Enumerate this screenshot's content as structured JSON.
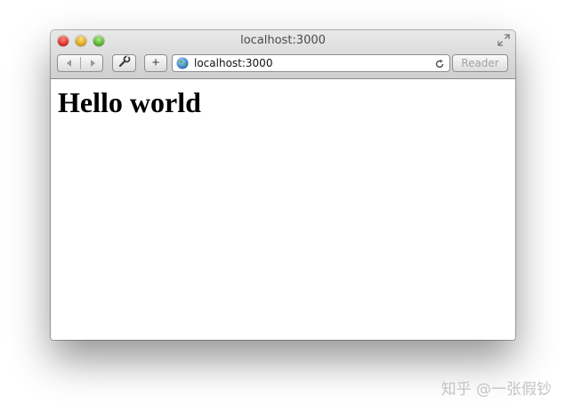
{
  "window": {
    "title": "localhost:3000"
  },
  "toolbar": {
    "add_label": "+",
    "address": "localhost:3000",
    "reader_label": "Reader"
  },
  "page": {
    "heading": "Hello world"
  },
  "watermark": "知乎 @一张假钞",
  "icons": [
    "fullscreen-icon",
    "back-arrow-icon",
    "forward-arrow-icon",
    "wrench-icon",
    "globe-icon",
    "reload-icon"
  ]
}
